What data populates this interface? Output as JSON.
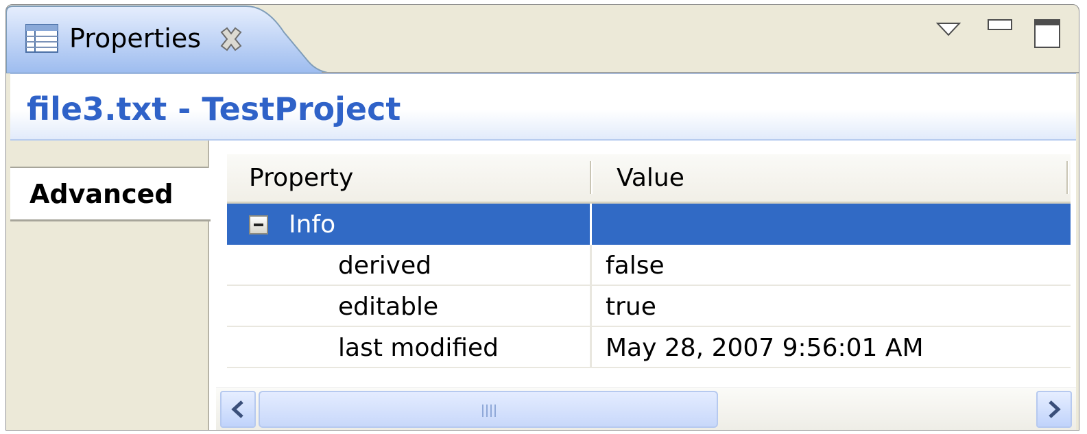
{
  "view": {
    "tab_label": "Properties",
    "tab_icon": "properties-table-icon",
    "close_icon": "close-icon",
    "view_menu_icon": "view-menu-triangle-icon",
    "minimize_icon": "minimize-icon",
    "maximize_icon": "maximize-icon"
  },
  "title": "file3.txt - TestProject",
  "sidebar": {
    "tabs": [
      {
        "label": "Advanced",
        "selected": true
      }
    ]
  },
  "table": {
    "columns": [
      "Property",
      "Value"
    ],
    "rows": [
      {
        "property": "Info",
        "value": "",
        "category": true,
        "expanded": true,
        "selected": true
      },
      {
        "property": "derived",
        "value": "false"
      },
      {
        "property": "editable",
        "value": "true"
      },
      {
        "property": "last modified",
        "value": "May 28, 2007 9:56:01 AM"
      }
    ]
  },
  "scrollbar": {
    "left_icon": "scroll-left-arrow-icon",
    "right_icon": "scroll-right-arrow-icon"
  },
  "colors": {
    "title_blue": "#2f62c8",
    "selection": "#316ac5",
    "tab_gradient_top": "#e3ecfd",
    "tab_gradient_bottom": "#9fbdef",
    "panel_background": "#ece9d8"
  }
}
